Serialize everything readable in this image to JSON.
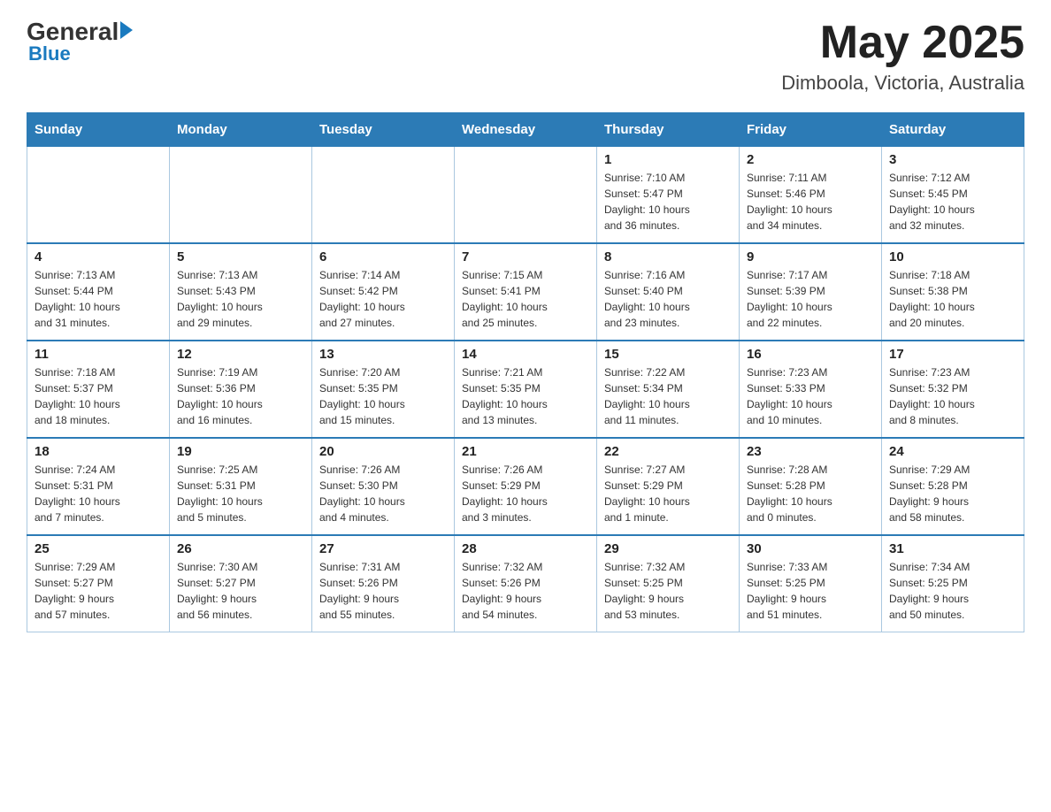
{
  "header": {
    "logo_general": "General",
    "logo_blue": "Blue",
    "month_title": "May 2025",
    "location": "Dimboola, Victoria, Australia"
  },
  "weekdays": [
    "Sunday",
    "Monday",
    "Tuesday",
    "Wednesday",
    "Thursday",
    "Friday",
    "Saturday"
  ],
  "weeks": [
    [
      {
        "day": "",
        "info": ""
      },
      {
        "day": "",
        "info": ""
      },
      {
        "day": "",
        "info": ""
      },
      {
        "day": "",
        "info": ""
      },
      {
        "day": "1",
        "info": "Sunrise: 7:10 AM\nSunset: 5:47 PM\nDaylight: 10 hours\nand 36 minutes."
      },
      {
        "day": "2",
        "info": "Sunrise: 7:11 AM\nSunset: 5:46 PM\nDaylight: 10 hours\nand 34 minutes."
      },
      {
        "day": "3",
        "info": "Sunrise: 7:12 AM\nSunset: 5:45 PM\nDaylight: 10 hours\nand 32 minutes."
      }
    ],
    [
      {
        "day": "4",
        "info": "Sunrise: 7:13 AM\nSunset: 5:44 PM\nDaylight: 10 hours\nand 31 minutes."
      },
      {
        "day": "5",
        "info": "Sunrise: 7:13 AM\nSunset: 5:43 PM\nDaylight: 10 hours\nand 29 minutes."
      },
      {
        "day": "6",
        "info": "Sunrise: 7:14 AM\nSunset: 5:42 PM\nDaylight: 10 hours\nand 27 minutes."
      },
      {
        "day": "7",
        "info": "Sunrise: 7:15 AM\nSunset: 5:41 PM\nDaylight: 10 hours\nand 25 minutes."
      },
      {
        "day": "8",
        "info": "Sunrise: 7:16 AM\nSunset: 5:40 PM\nDaylight: 10 hours\nand 23 minutes."
      },
      {
        "day": "9",
        "info": "Sunrise: 7:17 AM\nSunset: 5:39 PM\nDaylight: 10 hours\nand 22 minutes."
      },
      {
        "day": "10",
        "info": "Sunrise: 7:18 AM\nSunset: 5:38 PM\nDaylight: 10 hours\nand 20 minutes."
      }
    ],
    [
      {
        "day": "11",
        "info": "Sunrise: 7:18 AM\nSunset: 5:37 PM\nDaylight: 10 hours\nand 18 minutes."
      },
      {
        "day": "12",
        "info": "Sunrise: 7:19 AM\nSunset: 5:36 PM\nDaylight: 10 hours\nand 16 minutes."
      },
      {
        "day": "13",
        "info": "Sunrise: 7:20 AM\nSunset: 5:35 PM\nDaylight: 10 hours\nand 15 minutes."
      },
      {
        "day": "14",
        "info": "Sunrise: 7:21 AM\nSunset: 5:35 PM\nDaylight: 10 hours\nand 13 minutes."
      },
      {
        "day": "15",
        "info": "Sunrise: 7:22 AM\nSunset: 5:34 PM\nDaylight: 10 hours\nand 11 minutes."
      },
      {
        "day": "16",
        "info": "Sunrise: 7:23 AM\nSunset: 5:33 PM\nDaylight: 10 hours\nand 10 minutes."
      },
      {
        "day": "17",
        "info": "Sunrise: 7:23 AM\nSunset: 5:32 PM\nDaylight: 10 hours\nand 8 minutes."
      }
    ],
    [
      {
        "day": "18",
        "info": "Sunrise: 7:24 AM\nSunset: 5:31 PM\nDaylight: 10 hours\nand 7 minutes."
      },
      {
        "day": "19",
        "info": "Sunrise: 7:25 AM\nSunset: 5:31 PM\nDaylight: 10 hours\nand 5 minutes."
      },
      {
        "day": "20",
        "info": "Sunrise: 7:26 AM\nSunset: 5:30 PM\nDaylight: 10 hours\nand 4 minutes."
      },
      {
        "day": "21",
        "info": "Sunrise: 7:26 AM\nSunset: 5:29 PM\nDaylight: 10 hours\nand 3 minutes."
      },
      {
        "day": "22",
        "info": "Sunrise: 7:27 AM\nSunset: 5:29 PM\nDaylight: 10 hours\nand 1 minute."
      },
      {
        "day": "23",
        "info": "Sunrise: 7:28 AM\nSunset: 5:28 PM\nDaylight: 10 hours\nand 0 minutes."
      },
      {
        "day": "24",
        "info": "Sunrise: 7:29 AM\nSunset: 5:28 PM\nDaylight: 9 hours\nand 58 minutes."
      }
    ],
    [
      {
        "day": "25",
        "info": "Sunrise: 7:29 AM\nSunset: 5:27 PM\nDaylight: 9 hours\nand 57 minutes."
      },
      {
        "day": "26",
        "info": "Sunrise: 7:30 AM\nSunset: 5:27 PM\nDaylight: 9 hours\nand 56 minutes."
      },
      {
        "day": "27",
        "info": "Sunrise: 7:31 AM\nSunset: 5:26 PM\nDaylight: 9 hours\nand 55 minutes."
      },
      {
        "day": "28",
        "info": "Sunrise: 7:32 AM\nSunset: 5:26 PM\nDaylight: 9 hours\nand 54 minutes."
      },
      {
        "day": "29",
        "info": "Sunrise: 7:32 AM\nSunset: 5:25 PM\nDaylight: 9 hours\nand 53 minutes."
      },
      {
        "day": "30",
        "info": "Sunrise: 7:33 AM\nSunset: 5:25 PM\nDaylight: 9 hours\nand 51 minutes."
      },
      {
        "day": "31",
        "info": "Sunrise: 7:34 AM\nSunset: 5:25 PM\nDaylight: 9 hours\nand 50 minutes."
      }
    ]
  ]
}
